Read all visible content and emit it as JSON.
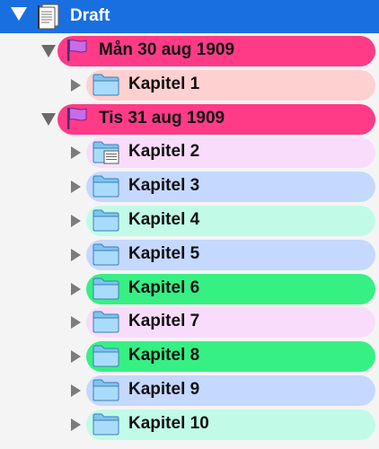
{
  "binder": {
    "root": {
      "label": "Draft",
      "icon": "draft-document-icon",
      "expanded": true,
      "colors": {
        "selection": "#1a6fe0"
      }
    },
    "groups": [
      {
        "label": "Mån 30 aug 1909",
        "icon": "flag-icon",
        "expanded": true,
        "color": "#ff3b88",
        "children": [
          {
            "label": "Kapitel 1",
            "icon": "folder-icon",
            "expanded": false,
            "color": "#ffd0d0"
          }
        ]
      },
      {
        "label": "Tis 31 aug 1909",
        "icon": "flag-icon",
        "expanded": true,
        "color": "#ff3b88",
        "children": [
          {
            "label": "Kapitel 2",
            "icon": "folder-text-icon",
            "expanded": false,
            "color": "#f9dcfb"
          },
          {
            "label": "Kapitel 3",
            "icon": "folder-icon",
            "expanded": false,
            "color": "#c5d8ff"
          },
          {
            "label": "Kapitel 4",
            "icon": "folder-icon",
            "expanded": false,
            "color": "#c1fbe8"
          },
          {
            "label": "Kapitel 5",
            "icon": "folder-icon",
            "expanded": false,
            "color": "#c5d8ff"
          },
          {
            "label": "Kapitel 6",
            "icon": "folder-icon",
            "expanded": false,
            "color": "#37f084"
          },
          {
            "label": "Kapitel 7",
            "icon": "folder-icon",
            "expanded": false,
            "color": "#f9dcfb"
          },
          {
            "label": "Kapitel 8",
            "icon": "folder-icon",
            "expanded": false,
            "color": "#37f084"
          },
          {
            "label": "Kapitel 9",
            "icon": "folder-icon",
            "expanded": false,
            "color": "#c5d8ff"
          },
          {
            "label": "Kapitel 10",
            "icon": "folder-icon",
            "expanded": false,
            "color": "#c1fbe8"
          }
        ]
      }
    ]
  }
}
